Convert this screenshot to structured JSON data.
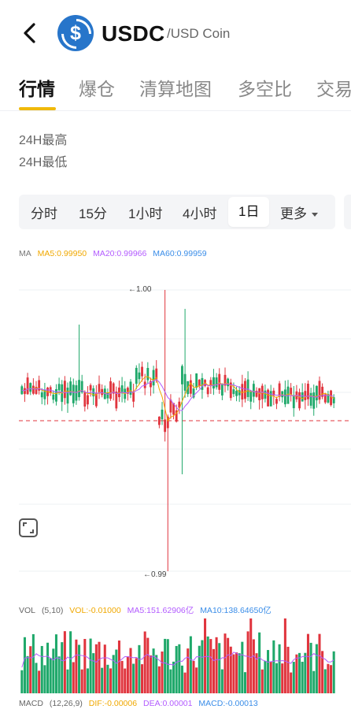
{
  "header": {
    "symbol": "USDC",
    "name": "/USD Coin",
    "logo_glyph": "$",
    "logo_color": "#2775ca"
  },
  "tabs": [
    {
      "label": "行情",
      "active": true
    },
    {
      "label": "爆仓"
    },
    {
      "label": "清算地图"
    },
    {
      "label": "多空比"
    },
    {
      "label": "交易"
    }
  ],
  "stats": {
    "high_label": "24H最高",
    "low_label": "24H最低"
  },
  "intervals": {
    "items": [
      "分时",
      "15分",
      "1小时",
      "4小时",
      "1日"
    ],
    "selected": "1日",
    "more_label": "更多"
  },
  "ma": {
    "label": "MA",
    "ma5": "MA5:0.99950",
    "ma20": "MA20:0.99966",
    "ma60": "MA60:0.99959",
    "colors": {
      "ma5": "#f0a800",
      "ma20": "#b35cff",
      "ma60": "#3a8de8"
    }
  },
  "chart_labels": {
    "high": "←1.00",
    "low": "←0.99"
  },
  "vol": {
    "label": "VOL",
    "params": "(5,10)",
    "vol": "VOL:-0.01000",
    "ma5": "MA5:151.62906亿",
    "ma10": "MA10:138.64650亿"
  },
  "macd": {
    "label": "MACD",
    "params": "(12,26,9)",
    "dif": "DIF:-0.00006",
    "dea": "DEA:0.00001",
    "macd": "MACD:-0.00013"
  },
  "colors": {
    "up": "#1fa86a",
    "down": "#e0343d",
    "accent": "#f0b90b"
  }
}
